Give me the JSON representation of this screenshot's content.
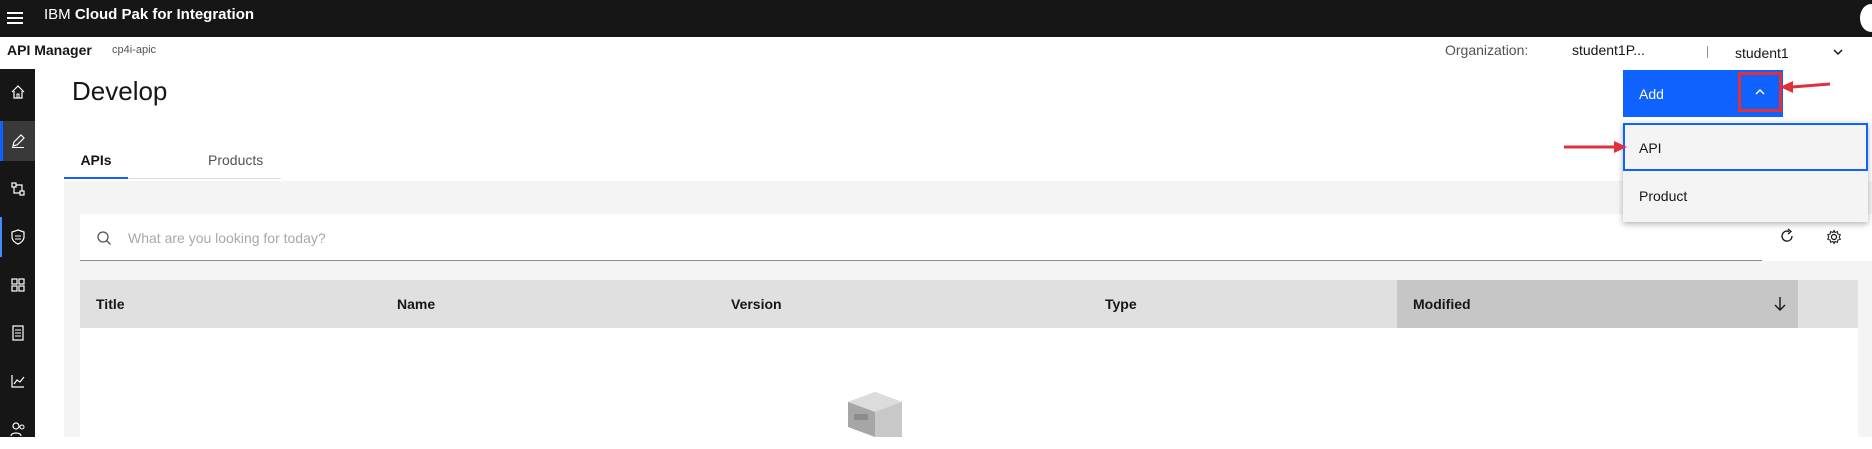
{
  "header": {
    "brand_prefix": "IBM",
    "brand_name": "Cloud Pak for Integration",
    "menu_icon": "hamburger-icon"
  },
  "subheader": {
    "app_name": "API Manager",
    "instance": "cp4i-apic",
    "org_label": "Organization:",
    "org_value": "student1P...",
    "user": "student1"
  },
  "nav": {
    "items": [
      "home-icon",
      "develop-icon",
      "manage-icon",
      "security-icon",
      "apps-icon",
      "catalog-icon",
      "analytics-icon",
      "members-icon"
    ],
    "active": "develop-icon"
  },
  "page": {
    "title": "Develop",
    "tabs": [
      {
        "label": "APIs"
      },
      {
        "label": "Products"
      }
    ],
    "search_placeholder": "What are you looking for today?"
  },
  "table": {
    "columns": [
      "Title",
      "Name",
      "Version",
      "Type",
      "Modified"
    ],
    "sorted_column": "Modified"
  },
  "add": {
    "label": "Add",
    "menu": [
      "API",
      "Product"
    ]
  },
  "colors": {
    "accent": "#0f62fe",
    "annotation": "#e0303a",
    "topbar": "#161616"
  }
}
